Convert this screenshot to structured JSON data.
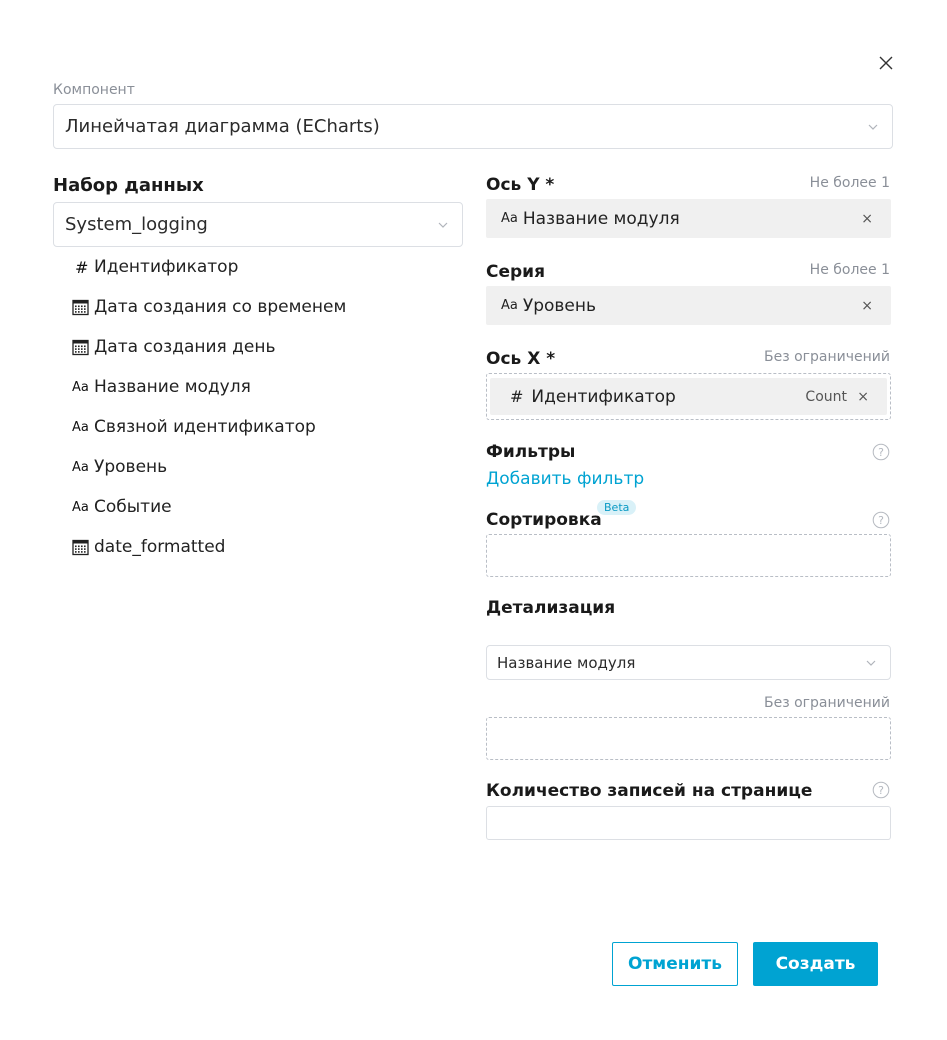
{
  "component": {
    "label": "Компонент",
    "value": "Линейчатая диаграмма (ECharts)"
  },
  "dataset": {
    "title": "Набор данных",
    "value": "System_logging",
    "fields": [
      {
        "icon": "hash-icon",
        "glyph": "#",
        "label": "Идентификатор"
      },
      {
        "icon": "calendar-icon",
        "glyph": "",
        "label": "Дата создания со временем"
      },
      {
        "icon": "calendar-icon",
        "glyph": "",
        "label": "Дата создания день"
      },
      {
        "icon": "text-type-icon",
        "glyph": "Aa",
        "label": "Название модуля"
      },
      {
        "icon": "text-type-icon",
        "glyph": "Aa",
        "label": "Связной идентификатор"
      },
      {
        "icon": "text-type-icon",
        "glyph": "Aa",
        "label": "Уровень"
      },
      {
        "icon": "text-type-icon",
        "glyph": "Aa",
        "label": "Событие"
      },
      {
        "icon": "calendar-icon",
        "glyph": "",
        "label": "date_formatted"
      }
    ]
  },
  "y_axis": {
    "title": "Ось Y *",
    "limit": "Не более 1",
    "chip_type": "Aa",
    "chip_label": "Название модуля",
    "remove": "×"
  },
  "series": {
    "title": "Серия",
    "limit": "Не более 1",
    "chip_type": "Aa",
    "chip_label": "Уровень",
    "remove": "×"
  },
  "x_axis": {
    "title": "Ось X *",
    "limit": "Без ограничений",
    "chip_type": "#",
    "chip_label": "Идентификатор",
    "aggregation": "Count",
    "remove": "×"
  },
  "filters": {
    "title": "Фильтры",
    "add_link": "Добавить фильтр"
  },
  "sorting": {
    "title": "Сортировка",
    "badge": "Beta"
  },
  "drilldown": {
    "title": "Детализация",
    "select_value": "Название модуля",
    "limit": "Без ограничений"
  },
  "page_size": {
    "title": "Количество записей на странице",
    "value": ""
  },
  "buttons": {
    "cancel": "Отменить",
    "create": "Создать"
  },
  "colors": {
    "accent": "#00a3d2",
    "chip_bg": "#f0f0f0",
    "muted_text": "#8a8f98",
    "border": "#dcdfe4"
  }
}
